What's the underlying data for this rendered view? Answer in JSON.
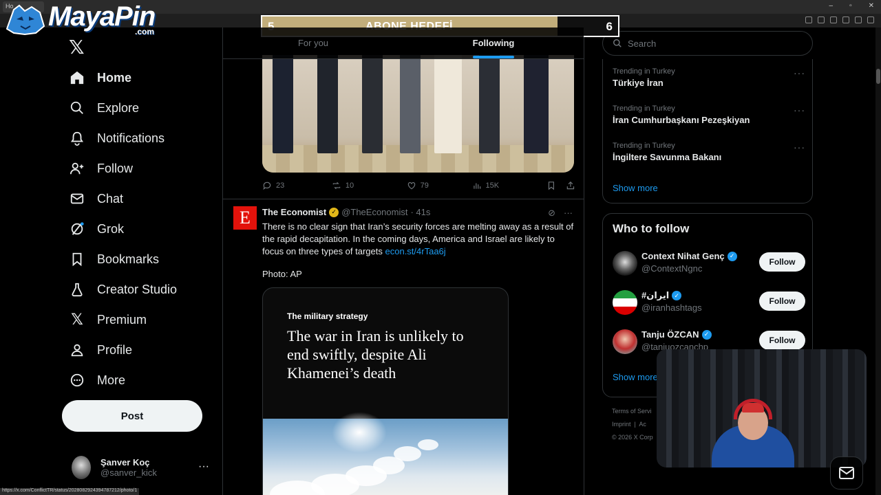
{
  "browser": {
    "tab_title": "Ho"
  },
  "overlay": {
    "logo_text": "MayaPin",
    "logo_suffix": ".com",
    "goal_label": "ABONE HEDEFİ",
    "goal_start": "5",
    "goal_end": "6",
    "goal_progress": 0.83
  },
  "sidebar": {
    "items": [
      {
        "label": "Home",
        "icon": "home-icon",
        "active": true
      },
      {
        "label": "Explore",
        "icon": "search-icon"
      },
      {
        "label": "Notifications",
        "icon": "bell-icon"
      },
      {
        "label": "Follow",
        "icon": "person-add-icon"
      },
      {
        "label": "Chat",
        "icon": "envelope-icon"
      },
      {
        "label": "Grok",
        "icon": "grok-icon"
      },
      {
        "label": "Bookmarks",
        "icon": "bookmark-icon"
      },
      {
        "label": "Creator Studio",
        "icon": "flask-icon"
      },
      {
        "label": "Premium",
        "icon": "x-icon"
      },
      {
        "label": "Profile",
        "icon": "person-icon"
      },
      {
        "label": "More",
        "icon": "more-circle-icon"
      }
    ],
    "post_label": "Post",
    "account": {
      "name": "Şanver Koç",
      "handle": "@sanver_kick"
    }
  },
  "feed": {
    "tabs": [
      {
        "label": "For you"
      },
      {
        "label": "Following",
        "active": true
      }
    ],
    "prev_tweet": {
      "replies": "23",
      "reposts": "10",
      "likes": "79",
      "views": "15K"
    },
    "tweet": {
      "name": "The Economist",
      "handle": "@TheEconomist",
      "time": "· 41s",
      "text": "There is no clear sign that Iran’s security forces are melting away as a result of the rapid decapitation. In the coming days, America and Israel are likely to focus on three types of targets ",
      "link": "econ.st/4rTaa6j",
      "photo_credit": "Photo: AP",
      "article_kicker": "The military strategy",
      "article_title": "The war in Iran is unlikely to end swiftly, despite Ali Khamenei’s death"
    }
  },
  "right": {
    "search_placeholder": "Search",
    "trends": [
      {
        "context": "Trending in Turkey",
        "title": "Türkiye İran"
      },
      {
        "context": "Trending in Turkey",
        "title": "İran Cumhurbaşkanı Pezeşkiyan"
      },
      {
        "context": "Trending in Turkey",
        "title": "İngiltere Savunma Bakanı"
      }
    ],
    "trends_show_more": "Show more",
    "who_to_follow_title": "Who to follow",
    "who_to_follow": [
      {
        "name": "Context Nihat Genç",
        "handle": "@ContextNgnc",
        "button": "Follow"
      },
      {
        "name": "#ایران",
        "handle": "@iranhashtags",
        "button": "Follow"
      },
      {
        "name": "Tanju ÖZCAN",
        "handle": "@tanjuozcanchp",
        "button": "Follow"
      }
    ],
    "wtf_show_more": "Show more",
    "footer": {
      "line1": "Terms of Servi",
      "line2a": "Imprint",
      "line2b": "Ac",
      "line3": "© 2026 X Corp"
    }
  },
  "status_url": "https://x.com/ConflictTR/status/2028082924394787212/photo/1",
  "colors": {
    "accent": "#1d9bf0",
    "economist_red": "#e3120b",
    "goal_fill": "#c2ae7b"
  }
}
